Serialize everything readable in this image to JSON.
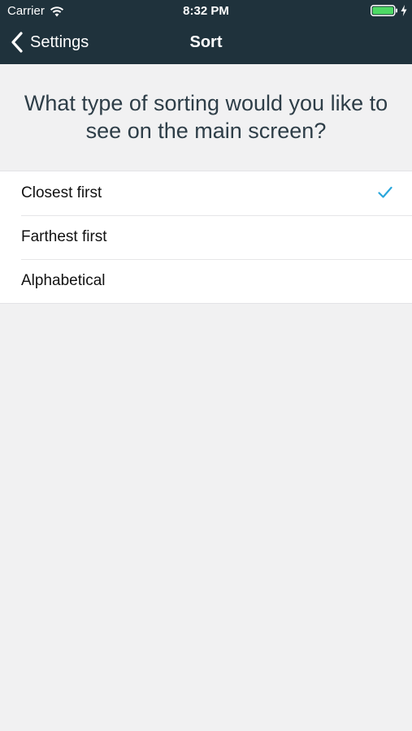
{
  "status_bar": {
    "carrier": "Carrier",
    "time": "8:32 PM",
    "icons": [
      "wifi-icon",
      "battery-icon",
      "charging-bolt-icon"
    ]
  },
  "nav": {
    "back_label": "Settings",
    "back_icon": "chevron-left-icon",
    "title": "Sort"
  },
  "prompt": "What type of sorting would you like to see on the main screen?",
  "options": [
    {
      "label": "Closest first",
      "selected": true
    },
    {
      "label": "Farthest first",
      "selected": false
    },
    {
      "label": "Alphabetical",
      "selected": false
    }
  ],
  "colors": {
    "nav_background": "#1f323c",
    "page_background": "#f1f1f2",
    "accent_check": "#2aa7dc",
    "question_text": "#2e3e48",
    "battery_fill": "#4cd964"
  }
}
